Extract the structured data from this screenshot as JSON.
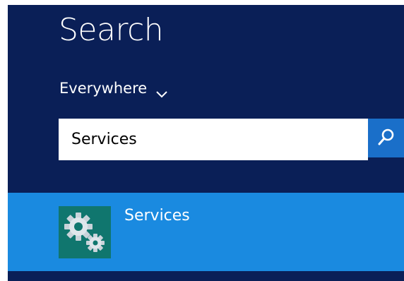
{
  "search_pane": {
    "title": "Search",
    "scope": {
      "selected": "Everywhere",
      "icon": "chevron-down-icon"
    },
    "query": {
      "value": "Services",
      "button_icon": "search-icon"
    },
    "results": [
      {
        "label": "Services",
        "icon": "services-gears-icon"
      }
    ]
  },
  "colors": {
    "pane_background": "#0a1f57",
    "search_button": "#1a6fc9",
    "result_highlight": "#1a8ae0",
    "icon_tile": "#10766e"
  }
}
